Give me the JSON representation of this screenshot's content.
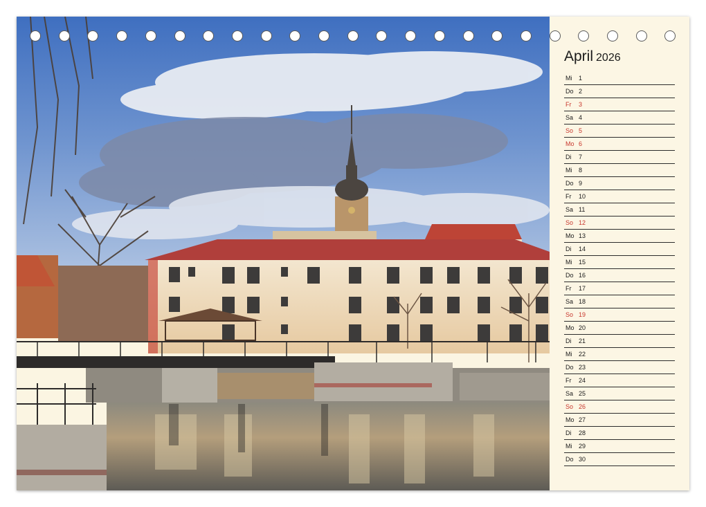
{
  "calendar": {
    "month": "April",
    "year": "2026",
    "days": [
      {
        "wd": "Mi",
        "d": "1",
        "type": "normal"
      },
      {
        "wd": "Do",
        "d": "2",
        "type": "normal"
      },
      {
        "wd": "Fr",
        "d": "3",
        "type": "hol"
      },
      {
        "wd": "Sa",
        "d": "4",
        "type": "normal"
      },
      {
        "wd": "So",
        "d": "5",
        "type": "sun"
      },
      {
        "wd": "Mo",
        "d": "6",
        "type": "hol"
      },
      {
        "wd": "Di",
        "d": "7",
        "type": "normal"
      },
      {
        "wd": "Mi",
        "d": "8",
        "type": "normal"
      },
      {
        "wd": "Do",
        "d": "9",
        "type": "normal"
      },
      {
        "wd": "Fr",
        "d": "10",
        "type": "normal"
      },
      {
        "wd": "Sa",
        "d": "11",
        "type": "normal"
      },
      {
        "wd": "So",
        "d": "12",
        "type": "sun"
      },
      {
        "wd": "Mo",
        "d": "13",
        "type": "normal"
      },
      {
        "wd": "Di",
        "d": "14",
        "type": "normal"
      },
      {
        "wd": "Mi",
        "d": "15",
        "type": "normal"
      },
      {
        "wd": "Do",
        "d": "16",
        "type": "normal"
      },
      {
        "wd": "Fr",
        "d": "17",
        "type": "normal"
      },
      {
        "wd": "Sa",
        "d": "18",
        "type": "normal"
      },
      {
        "wd": "So",
        "d": "19",
        "type": "sun"
      },
      {
        "wd": "Mo",
        "d": "20",
        "type": "normal"
      },
      {
        "wd": "Di",
        "d": "21",
        "type": "normal"
      },
      {
        "wd": "Mi",
        "d": "22",
        "type": "normal"
      },
      {
        "wd": "Do",
        "d": "23",
        "type": "normal"
      },
      {
        "wd": "Fr",
        "d": "24",
        "type": "normal"
      },
      {
        "wd": "Sa",
        "d": "25",
        "type": "normal"
      },
      {
        "wd": "So",
        "d": "26",
        "type": "sun"
      },
      {
        "wd": "Mo",
        "d": "27",
        "type": "normal"
      },
      {
        "wd": "Di",
        "d": "28",
        "type": "normal"
      },
      {
        "wd": "Mi",
        "d": "29",
        "type": "normal"
      },
      {
        "wd": "Do",
        "d": "30",
        "type": "normal"
      }
    ]
  },
  "colors": {
    "sunday_holiday": "#c8372d",
    "text": "#1a1a1a",
    "panel_background": "#fcf6e4",
    "sky": "#5b82c4",
    "roof": "#b8403a",
    "facade": "#f0dfc2"
  }
}
